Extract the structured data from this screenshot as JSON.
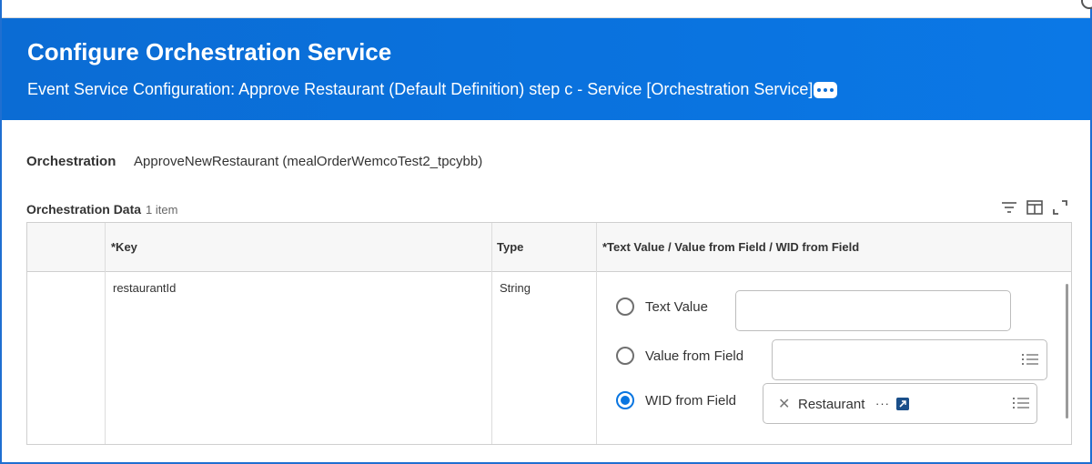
{
  "header": {
    "title": "Configure Orchestration Service",
    "subtitle": "Event Service Configuration: Approve Restaurant (Default Definition) step c - Service [Orchestration Service]",
    "more_icon": "ellipsis-icon",
    "background_color": "#0875e1"
  },
  "orchestration": {
    "label": "Orchestration",
    "value": "ApproveNewRestaurant (mealOrderWemcoTest2_tpcybb)"
  },
  "grid": {
    "title": "Orchestration Data",
    "count": "1 item",
    "toolbar_icons": [
      "filter-icon",
      "columns-icon",
      "expand-icon"
    ],
    "columns": [
      "",
      "*Key",
      "Type",
      "*Text Value / Value from Field / WID from Field"
    ],
    "rows": [
      {
        "key": "restaurantId",
        "type": "String",
        "options": [
          {
            "label": "Text Value",
            "selected": false,
            "value": ""
          },
          {
            "label": "Value from Field",
            "selected": false,
            "value": ""
          },
          {
            "label": "WID from Field",
            "selected": true,
            "value": "Restaurant"
          }
        ]
      }
    ]
  },
  "colors": {
    "accent": "#0875e1",
    "frame": "#1f6fd1"
  }
}
